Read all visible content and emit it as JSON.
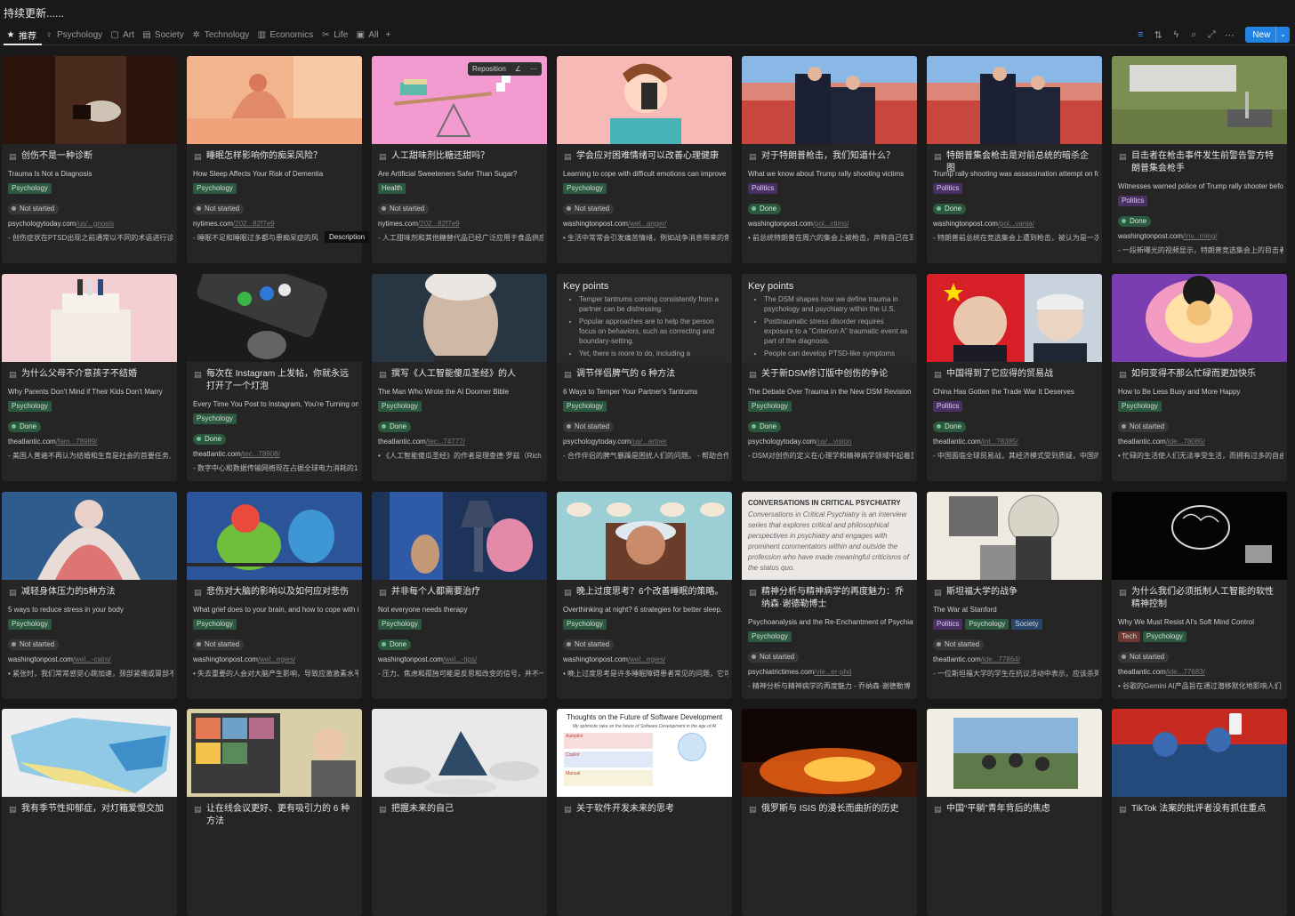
{
  "page_title": "持续更新......",
  "tabs": [
    {
      "label": "推荐",
      "icon": "star-icon",
      "glyph": "★",
      "active": true
    },
    {
      "label": "Psychology",
      "icon": "bulb-icon",
      "glyph": "♀",
      "active": false
    },
    {
      "label": "Art",
      "icon": "art-icon",
      "glyph": "▢",
      "active": false
    },
    {
      "label": "Society",
      "icon": "book-icon",
      "glyph": "▤",
      "active": false
    },
    {
      "label": "Technology",
      "icon": "cog-icon",
      "glyph": "✲",
      "active": false
    },
    {
      "label": "Economics",
      "icon": "chart-icon",
      "glyph": "▥",
      "active": false
    },
    {
      "label": "Life",
      "icon": "scissors-icon",
      "glyph": "✂",
      "active": false
    },
    {
      "label": "All",
      "icon": "archive-icon",
      "glyph": "▣",
      "active": false
    }
  ],
  "add_tab_glyph": "+",
  "toolbar": {
    "icons": [
      {
        "name": "filter-icon",
        "glyph": "≡",
        "blue": true
      },
      {
        "name": "sort-icon",
        "glyph": "⇅",
        "blue": false
      },
      {
        "name": "lightning-icon",
        "glyph": "ϟ",
        "blue": false
      },
      {
        "name": "search-icon",
        "glyph": "⌕",
        "blue": false
      },
      {
        "name": "expand-icon",
        "glyph": "⤢",
        "blue": false
      },
      {
        "name": "more-icon",
        "glyph": "⋯",
        "blue": false
      }
    ],
    "new_label": "New",
    "new_arrow": "⌄"
  },
  "overlay": {
    "reposition": "Reposition",
    "edit_glyph": "∠",
    "more_glyph": "⋯"
  },
  "tooltip": "Description",
  "cards": [
    {
      "title": "创伤不是一种诊断",
      "subtitle": "Trauma Is Not a Diagnosis",
      "tags": [
        "Psychology"
      ],
      "status": "Not started",
      "domain": "psychologytoday.com",
      "path": "/us/...gnosis",
      "desc": "- 创伤症状在PTSD出现之前通常以不同的术语进行诊断",
      "cover": "dark-brown"
    },
    {
      "title": "睡眠怎样影响你的痴呆风险？",
      "subtitle": "How Sleep Affects Your Risk of Dementia",
      "tags": [
        "Psychology"
      ],
      "status": "Not started",
      "domain": "nytimes.com",
      "path": "/202...82f7e9",
      "desc": "- 睡眠不足和睡眠过多都与患痴呆症的风",
      "cover": "sleep-art"
    },
    {
      "title": "人工甜味剂比糖还甜吗？",
      "subtitle": "Are Artificial Sweeteners Safer Than Sugar?",
      "tags": [
        "Health"
      ],
      "status": "Not started",
      "domain": "nytimes.com",
      "path": "/202...82f7e9",
      "desc": "- 人工甜味剂和其他糖替代品已经广泛应用于食品供应",
      "cover": "pink-seesaw"
    },
    {
      "title": "学会应对困难情绪可以改善心理健康",
      "subtitle": "Learning to cope with difficult emotions can improve mental health",
      "tags": [
        "Psychology"
      ],
      "status": "Not started",
      "domain": "washingtonpost.com",
      "path": "/wel...anger/",
      "desc": "• 生活中常常会引发痛苦情绪，例如战争消息带来的焦虑",
      "cover": "pink-woman"
    },
    {
      "title": "对于特朗普枪击，我们知道什么？",
      "subtitle": "What we know about Trump rally shooting victims",
      "tags": [
        "Politics"
      ],
      "status": "Done",
      "domain": "washingtonpost.com",
      "path": "/pol...ctims/",
      "desc": "• 前总统特朗普在周六的集会上被枪击，声称自己在耳",
      "cover": "rally"
    },
    {
      "title": "特朗普集会枪击是对前总统的暗杀企图",
      "subtitle": "Trump rally shooting was assassination attempt on former president",
      "tags": [
        "Politics"
      ],
      "status": "Done",
      "domain": "washingtonpost.com",
      "path": "/pol...vania/",
      "desc": "- 特朗普前总统在竞选集会上遭到枪击，被认为是一次",
      "cover": "rally"
    },
    {
      "title": "目击者在枪击事件发生前警告警方特朗普集会枪手",
      "subtitle": "Witnesses warned police of Trump rally shooter before attack",
      "tags": [
        "Politics"
      ],
      "status": "Done",
      "domain": "washingtonpost.com",
      "path": "/inv...rning/",
      "desc": "- 一段新曝光的视频显示，特朗普竞选集会上的目击者",
      "cover": "aerial"
    },
    {
      "title": "为什么父母不介意孩子不结婚",
      "subtitle": "Why Parents Don't Mind if Their Kids Don't Marry",
      "tags": [
        "Psychology"
      ],
      "status": "Done",
      "domain": "theatlantic.com",
      "path": "/fam...78989/",
      "desc": "- 美国人普遍不再认为结婚和生育是社会的首要任务,",
      "cover": "cake"
    },
    {
      "title": "每次在 Instagram 上发帖，你就永远打开了一个灯泡",
      "subtitle": "Every Time You Post to Instagram, You're Turning on a Light Bulb Forever",
      "tags": [
        "Psychology"
      ],
      "status": "Done",
      "domain": "theatlantic.com",
      "path": "/tec...78908/",
      "desc": "- 数字中心和数据传输网络现在占据全球电力消耗的1",
      "cover": "phone"
    },
    {
      "title": "撰写《人工智能傻瓜圣经》的人",
      "subtitle": "The Man Who Wrote the AI Doomer Bible",
      "tags": [
        "Psychology"
      ],
      "status": "Done",
      "domain": "theatlantic.com",
      "path": "/tec...74777/",
      "desc": "• 《人工智能傻瓜圣经》的作者是理查德·罗兹（Rich",
      "cover": "portrait"
    },
    {
      "title": "调节伴侣脾气的 6 种方法",
      "subtitle": "6 Ways to Temper Your Partner's Tantrums",
      "tags": [
        "Psychology"
      ],
      "status": "Not started",
      "domain": "psychologytoday.com",
      "path": "/us/...artner",
      "desc": "- 合作伴侣的脾气暴躁是困扰人们的问题。 - 帮助合作",
      "cover": "keypoints",
      "kp_title": "Key points",
      "kp_items": [
        "Temper tantrums coming consistently from a partner can be distressing.",
        "Popular approaches are to help the person focus on behaviors, such as correcting and boundary-setting.",
        "Yet, there is more to do, including a"
      ]
    },
    {
      "title": "关于新DSM修订版中创伤的争论",
      "subtitle": "The Debate Over Trauma in the New DSM Revision",
      "tags": [
        "Psychology"
      ],
      "status": "Done",
      "domain": "psychologytoday.com",
      "path": "/us/...vision",
      "desc": "- DSM对创伤的定义在心理学和精神病学领域中起着重",
      "cover": "keypoints",
      "kp_title": "Key points",
      "kp_items": [
        "The DSM shapes how we define trauma in psychology and psychiatry within the U.S.",
        "Posttraumatic stress disorder requires exposure to a \"Criterion A\" traumatic event as part of the diagnosis.",
        "People can develop PTSD-like symptoms"
      ]
    },
    {
      "title": "中国得到了它应得的贸易战",
      "subtitle": "China Has Gotten the Trade War It Deserves",
      "tags": [
        "Politics"
      ],
      "status": "Done",
      "domain": "theatlantic.com",
      "path": "/int...78385/",
      "desc": "- 中国面临全球贸易战，其经济模式受到质疑，中国的",
      "cover": "flags"
    },
    {
      "title": "如何变得不那么忙碌而更加快乐",
      "subtitle": "How to Be Less Busy and More Happy",
      "tags": [
        "Psychology"
      ],
      "status": "Not started",
      "domain": "theatlantic.com",
      "path": "/ide...78085/",
      "desc": "• 忙碌的生活使人们无法享受生活，而拥有过多的自由",
      "cover": "purple-face"
    },
    {
      "title": "减轻身体压力的5种方法",
      "subtitle": "5 ways to reduce stress in your body",
      "tags": [
        "Psychology"
      ],
      "status": "Not started",
      "domain": "washingtonpost.com",
      "path": "/wel...-calm/",
      "desc": "• 紧张时，我们常常感觉心跳加速，颈部紧绷或胃部不",
      "cover": "stress"
    },
    {
      "title": "悲伤对大脑的影响以及如何应对悲伤",
      "subtitle": "What grief does to your brain, and how to cope with it",
      "tags": [
        "Psychology"
      ],
      "status": "Not started",
      "domain": "washingtonpost.com",
      "path": "/wel...egies/",
      "desc": "• 失去重要的人会对大脑产生影响，导致应激激素水平",
      "cover": "birds"
    },
    {
      "title": "并非每个人都需要治疗",
      "subtitle": "Not everyone needs therapy",
      "tags": [
        "Psychology"
      ],
      "status": "Done",
      "domain": "washingtonpost.com",
      "path": "/wel...-tips/",
      "desc": "- 压力、焦虑和孤独可能是反思和改变的信号，并不一",
      "cover": "lamp"
    },
    {
      "title": "晚上过度思考？6个改善睡眠的策略。",
      "subtitle": "Overthinking at night? 6 strategies for better sleep.",
      "tags": [
        "Psychology"
      ],
      "status": "Not started",
      "domain": "washingtonpost.com",
      "path": "/wel...egies/",
      "desc": "• 晚上过度思考是许多睡眠障碍患者常见的问题，它可",
      "cover": "eyes"
    },
    {
      "title": "精神分析与精神病学的再度魅力：乔纳森·谢德勒博士",
      "subtitle": "Psychoanalysis and the Re-Enchantment of Psychiatry",
      "tags": [
        "Psychology"
      ],
      "status": "Not started",
      "domain": "psychiatrictimes.com",
      "path": "/vie...er-phd",
      "desc": "- 精神分析与精神病学的再度魅力 - 乔纳森·谢德勒博",
      "cover": "essay",
      "essay_title": "CONVERSATIONS IN CRITICAL PSYCHIATRY",
      "essay_body": "Conversations in Critical Psychiatry is an interview series that explores critical and philosophical perspectives in psychiatry and engages with prominent commentators within and outside the profession who have made meaningful criticisms of the status quo."
    },
    {
      "title": "斯坦福大学的战争",
      "subtitle": "The War at Stanford",
      "tags": [
        "Politics",
        "Psychology",
        "Society"
      ],
      "status": "Not started",
      "domain": "theatlantic.com",
      "path": "/ide...77864/",
      "desc": "- 一位斯坦福大学的学生在抗议活动中表示，应该杀死",
      "cover": "collage"
    },
    {
      "title": "为什么我们必须抵制人工智能的软性精神控制",
      "subtitle": "Why We Must Resist AI's Soft Mind Control",
      "tags": [
        "Tech",
        "Psychology"
      ],
      "status": "Not started",
      "domain": "theatlantic.com",
      "path": "/ide...77683/",
      "desc": "• 谷歌的Gemini AI产品旨在通过潜移默化地影响人们",
      "cover": "brain"
    },
    {
      "title": "我有季节性抑郁症，对灯箱爱恨交加",
      "subtitle": "",
      "tags": [],
      "status": "",
      "domain": "",
      "path": "",
      "desc": "",
      "cover": "map"
    },
    {
      "title": "让在线会议更好、更有吸引力的 6 种方法",
      "subtitle": "",
      "tags": [],
      "status": "",
      "domain": "",
      "path": "",
      "desc": "",
      "cover": "meeting"
    },
    {
      "title": "把握未来的自己",
      "subtitle": "",
      "tags": [],
      "status": "",
      "domain": "",
      "path": "",
      "desc": "",
      "cover": "clouds"
    },
    {
      "title": "关于软件开发未来的思考",
      "subtitle": "",
      "tags": [],
      "status": "",
      "domain": "",
      "path": "",
      "desc": "",
      "cover": "slide",
      "slide_title": "Thoughts on the Future of Software Development",
      "slide_sub": "My optimistic take on the future of Software Development in the age of AI",
      "slide_labels": [
        "Autopilot",
        "Copilot",
        "Manual"
      ]
    },
    {
      "title": "俄罗斯与 ISIS 的漫长而曲折的历史",
      "subtitle": "",
      "tags": [],
      "status": "",
      "domain": "",
      "path": "",
      "desc": "",
      "cover": "fire"
    },
    {
      "title": "中国“平躺”青年背后的焦虑",
      "subtitle": "",
      "tags": [],
      "status": "",
      "domain": "",
      "path": "",
      "desc": "",
      "cover": "youth"
    },
    {
      "title": "TikTok 法案的批评者没有抓住重点",
      "subtitle": "",
      "tags": [],
      "status": "",
      "domain": "",
      "path": "",
      "desc": "",
      "cover": "tiktok"
    }
  ]
}
